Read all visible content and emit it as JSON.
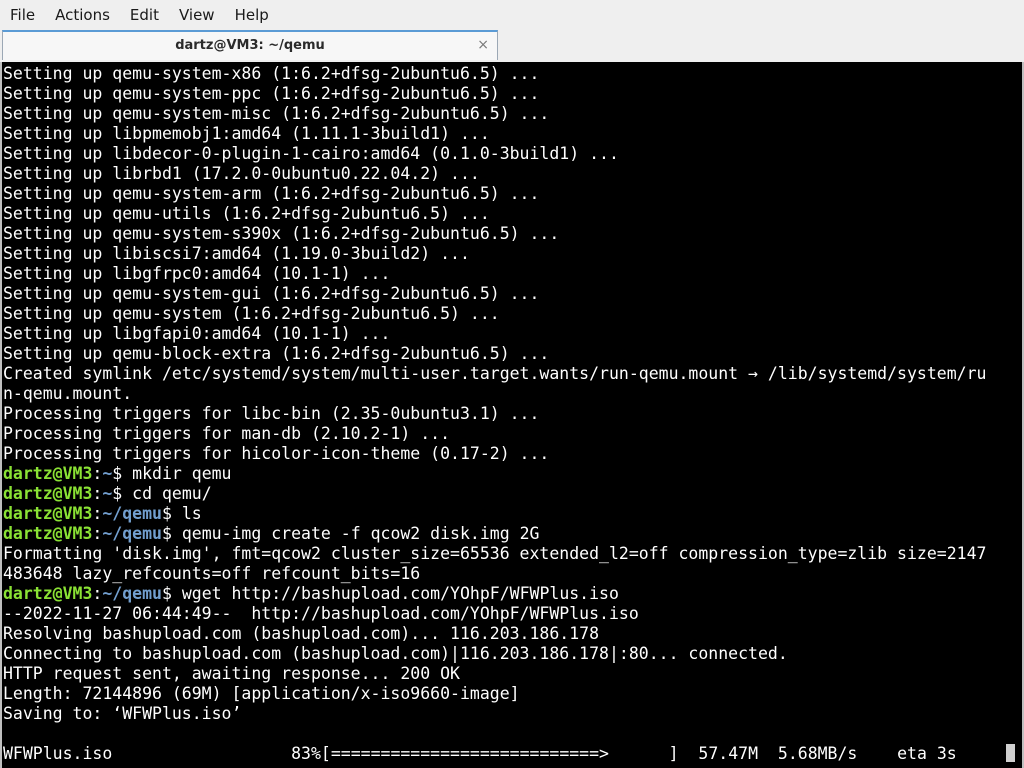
{
  "menubar": {
    "items": [
      "File",
      "Actions",
      "Edit",
      "View",
      "Help"
    ]
  },
  "tab": {
    "title": "dartz@VM3: ~/qemu",
    "close_glyph": "×"
  },
  "colors": {
    "terminal_bg": "#000000",
    "prompt_user": "#8ae234",
    "prompt_path": "#729fcf",
    "text": "#ffffff"
  },
  "terminal": {
    "lines": [
      {
        "type": "out",
        "text": "Setting up qemu-system-x86 (1:6.2+dfsg-2ubuntu6.5) ..."
      },
      {
        "type": "out",
        "text": "Setting up qemu-system-ppc (1:6.2+dfsg-2ubuntu6.5) ..."
      },
      {
        "type": "out",
        "text": "Setting up qemu-system-misc (1:6.2+dfsg-2ubuntu6.5) ..."
      },
      {
        "type": "out",
        "text": "Setting up libpmemobj1:amd64 (1.11.1-3build1) ..."
      },
      {
        "type": "out",
        "text": "Setting up libdecor-0-plugin-1-cairo:amd64 (0.1.0-3build1) ..."
      },
      {
        "type": "out",
        "text": "Setting up librbd1 (17.2.0-0ubuntu0.22.04.2) ..."
      },
      {
        "type": "out",
        "text": "Setting up qemu-system-arm (1:6.2+dfsg-2ubuntu6.5) ..."
      },
      {
        "type": "out",
        "text": "Setting up qemu-utils (1:6.2+dfsg-2ubuntu6.5) ..."
      },
      {
        "type": "out",
        "text": "Setting up qemu-system-s390x (1:6.2+dfsg-2ubuntu6.5) ..."
      },
      {
        "type": "out",
        "text": "Setting up libiscsi7:amd64 (1.19.0-3build2) ..."
      },
      {
        "type": "out",
        "text": "Setting up libgfrpc0:amd64 (10.1-1) ..."
      },
      {
        "type": "out",
        "text": "Setting up qemu-system-gui (1:6.2+dfsg-2ubuntu6.5) ..."
      },
      {
        "type": "out",
        "text": "Setting up qemu-system (1:6.2+dfsg-2ubuntu6.5) ..."
      },
      {
        "type": "out",
        "text": "Setting up libgfapi0:amd64 (10.1-1) ..."
      },
      {
        "type": "out",
        "text": "Setting up qemu-block-extra (1:6.2+dfsg-2ubuntu6.5) ..."
      },
      {
        "type": "out",
        "text": "Created symlink /etc/systemd/system/multi-user.target.wants/run-qemu.mount → /lib/systemd/system/ru"
      },
      {
        "type": "out",
        "text": "n-qemu.mount."
      },
      {
        "type": "out",
        "text": "Processing triggers for libc-bin (2.35-0ubuntu3.1) ..."
      },
      {
        "type": "out",
        "text": "Processing triggers for man-db (2.10.2-1) ..."
      },
      {
        "type": "out",
        "text": "Processing triggers for hicolor-icon-theme (0.17-2) ..."
      },
      {
        "type": "prompt",
        "user": "dartz@VM3",
        "colon": ":",
        "path": "~",
        "dollar": "$ ",
        "cmd": "mkdir qemu"
      },
      {
        "type": "prompt",
        "user": "dartz@VM3",
        "colon": ":",
        "path": "~",
        "dollar": "$ ",
        "cmd": "cd qemu/"
      },
      {
        "type": "prompt",
        "user": "dartz@VM3",
        "colon": ":",
        "path": "~/qemu",
        "dollar": "$ ",
        "cmd": "ls"
      },
      {
        "type": "prompt",
        "user": "dartz@VM3",
        "colon": ":",
        "path": "~/qemu",
        "dollar": "$ ",
        "cmd": "qemu-img create -f qcow2 disk.img 2G"
      },
      {
        "type": "out",
        "text": "Formatting 'disk.img', fmt=qcow2 cluster_size=65536 extended_l2=off compression_type=zlib size=2147"
      },
      {
        "type": "out",
        "text": "483648 lazy_refcounts=off refcount_bits=16"
      },
      {
        "type": "prompt",
        "user": "dartz@VM3",
        "colon": ":",
        "path": "~/qemu",
        "dollar": "$ ",
        "cmd": "wget http://bashupload.com/YOhpF/WFWPlus.iso"
      },
      {
        "type": "out",
        "text": "--2022-11-27 06:44:49--  http://bashupload.com/YOhpF/WFWPlus.iso"
      },
      {
        "type": "out",
        "text": "Resolving bashupload.com (bashupload.com)... 116.203.186.178"
      },
      {
        "type": "out",
        "text": "Connecting to bashupload.com (bashupload.com)|116.203.186.178|:80... connected."
      },
      {
        "type": "out",
        "text": "HTTP request sent, awaiting response... 200 OK"
      },
      {
        "type": "out",
        "text": "Length: 72144896 (69M) [application/x-iso9660-image]"
      },
      {
        "type": "out",
        "text": "Saving to: ‘WFWPlus.iso’"
      }
    ],
    "progress": {
      "filename": "WFWPlus.iso",
      "percent": "83%",
      "bar": "[===========================>      ]",
      "received": "57.47M",
      "speed": "5.68MB/s",
      "eta_label": "eta",
      "eta": "3s"
    }
  }
}
